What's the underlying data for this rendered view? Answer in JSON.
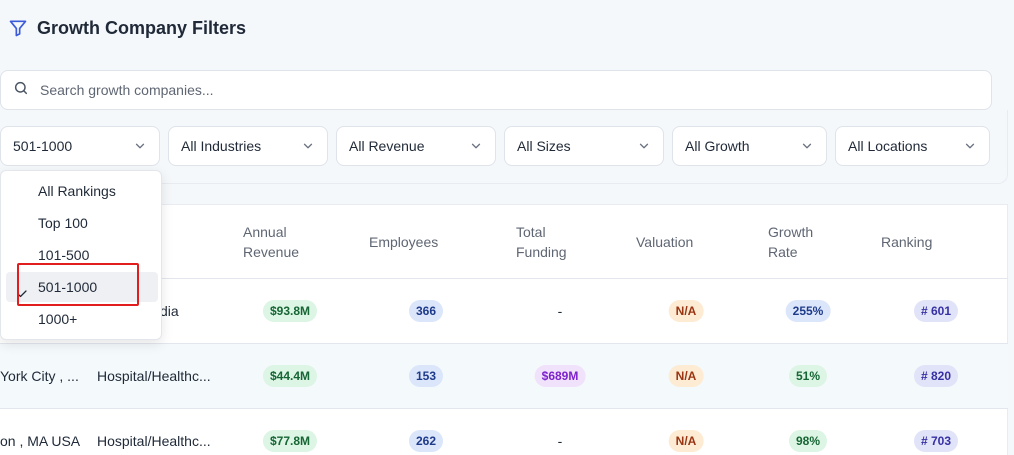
{
  "header": {
    "title": "Growth Company Filters",
    "icon": "filter-icon"
  },
  "search": {
    "placeholder": "Search growth companies...",
    "icon": "search-icon"
  },
  "filters": [
    {
      "value": "501-1000"
    },
    {
      "value": "All Industries"
    },
    {
      "value": "All Revenue"
    },
    {
      "value": "All Sizes"
    },
    {
      "value": "All Growth"
    },
    {
      "value": "All Locations"
    }
  ],
  "ranking_dropdown": {
    "options": [
      "All Rankings",
      "Top 100",
      "101-500",
      "501-1000",
      "1000+"
    ],
    "selected": "501-1000"
  },
  "table": {
    "headers": {
      "revenue": [
        "Annual",
        "Revenue"
      ],
      "employees": "Employees",
      "funding": [
        "Total",
        "Funding"
      ],
      "valuation": "Valuation",
      "growth": [
        "Growth",
        "Rate"
      ],
      "ranking": "Ranking"
    },
    "rows": [
      {
        "location": "",
        "industry": "dia",
        "revenue": "$93.8M",
        "employees": "366",
        "funding": "-",
        "valuation": "N/A",
        "growth": "255%",
        "ranking": "# 601"
      },
      {
        "location": "York City , ...",
        "industry": "Hospital/Healthc...",
        "revenue": "$44.4M",
        "employees": "153",
        "funding": "$689M",
        "valuation": "N/A",
        "growth": "51%",
        "ranking": "# 820"
      },
      {
        "location": "on , MA USA",
        "industry": "Hospital/Healthc...",
        "revenue": "$77.8M",
        "employees": "262",
        "funding": "-",
        "valuation": "N/A",
        "growth": "98%",
        "ranking": "# 703"
      }
    ]
  },
  "colors": {
    "accent": "#3b5bdb",
    "highlight_box": "#e11d1d",
    "revenue_badge": "#dcf5e4",
    "employees_badge": "#dbe6fb",
    "funding_badge": "#f1e2fb",
    "valuation_badge": "#fdebd3",
    "ranking_badge": "#e1e3f9"
  }
}
